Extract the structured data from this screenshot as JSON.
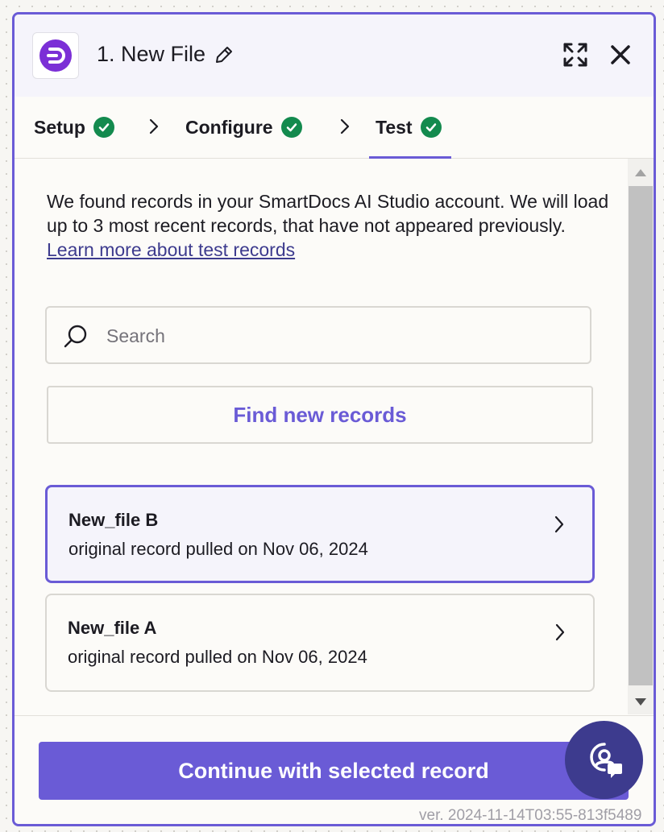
{
  "header": {
    "title": "1. New File",
    "icons": {
      "app": "smartdocs-logo",
      "edit": "pencil-icon",
      "expand": "expand-icon",
      "close": "close-icon"
    }
  },
  "tabs": [
    {
      "label": "Setup",
      "status": "complete"
    },
    {
      "label": "Configure",
      "status": "complete"
    },
    {
      "label": "Test",
      "status": "complete",
      "active": true
    }
  ],
  "content": {
    "description": "We found records in your SmartDocs AI Studio account. We will load up to 3 most recent records, that have not appeared previously.",
    "learn_more": "Learn more about test records",
    "search": {
      "placeholder": "Search",
      "value": ""
    },
    "find_button": "Find new records",
    "records": [
      {
        "name": "New_file B",
        "subtitle": "original record pulled on Nov 06, 2024",
        "selected": true
      },
      {
        "name": "New_file A",
        "subtitle": "original record pulled on Nov 06, 2024",
        "selected": false
      }
    ]
  },
  "footer": {
    "continue_button": "Continue with selected record"
  },
  "version": "ver. 2024-11-14T03:55-813f5489",
  "colors": {
    "accent": "#6a5bd6",
    "success": "#138a4e",
    "help_fab": "#3d3b8e",
    "logo": "#7b2fd6"
  }
}
